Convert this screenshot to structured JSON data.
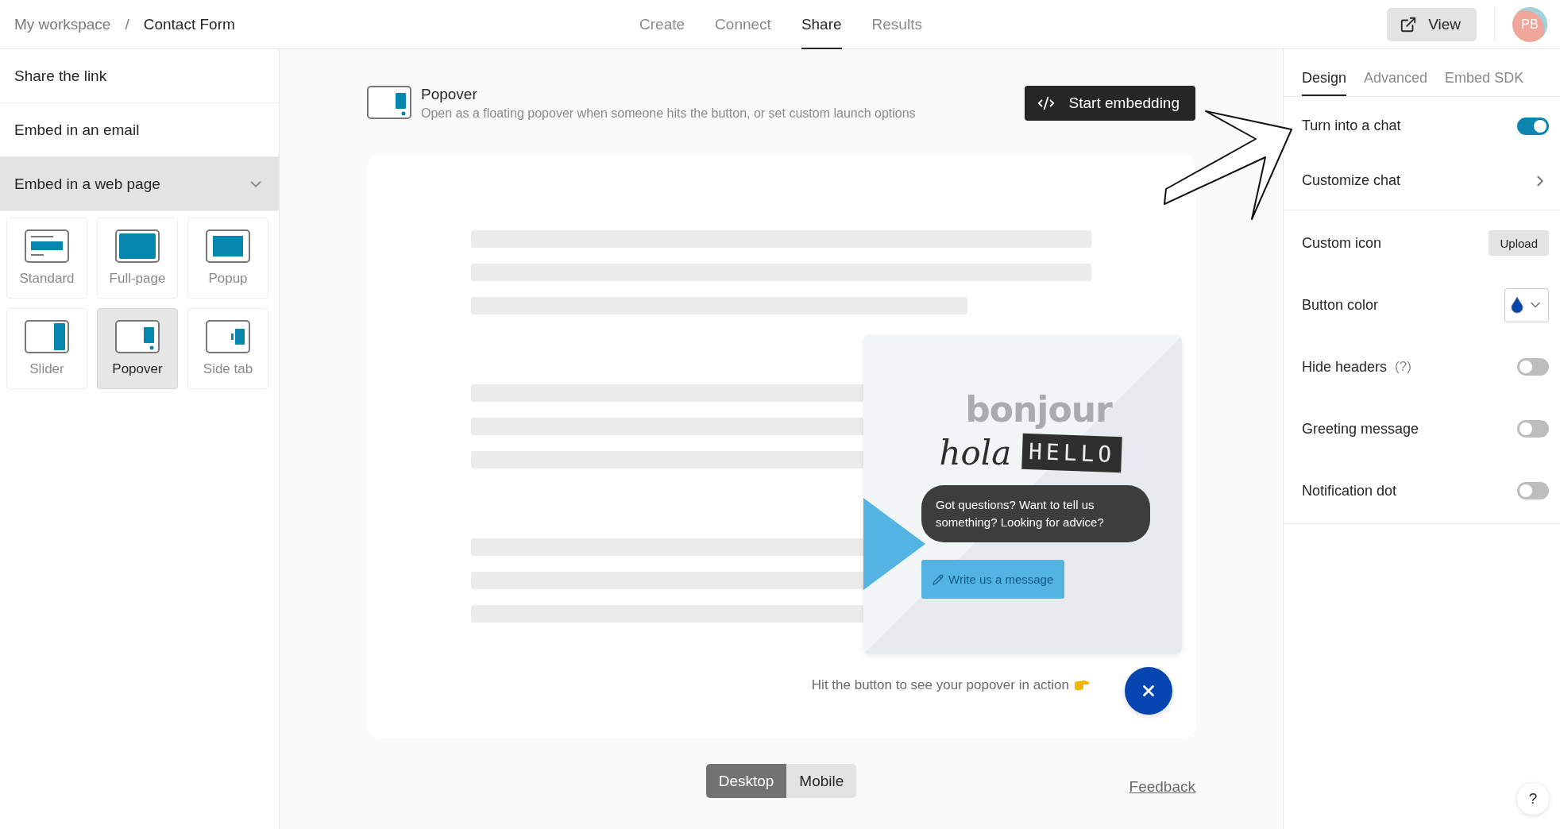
{
  "breadcrumb": {
    "workspace": "My workspace",
    "separator": "/",
    "form": "Contact Form"
  },
  "nav_tabs": [
    {
      "label": "Create",
      "selected": false
    },
    {
      "label": "Connect",
      "selected": false
    },
    {
      "label": "Share",
      "selected": true
    },
    {
      "label": "Results",
      "selected": false
    }
  ],
  "view_button": "View",
  "avatar": "PB",
  "sidebar": {
    "items": [
      {
        "kind": "link",
        "label": "Share the link",
        "selected": false
      },
      {
        "kind": "link",
        "label": "Embed in an email",
        "selected": false
      },
      {
        "kind": "section",
        "label": "Embed in a web page",
        "selected": true,
        "expanded": true,
        "options": [
          {
            "kind": "standard",
            "label": "Standard",
            "selected": false
          },
          {
            "kind": "full-page",
            "label": "Full-page",
            "selected": false
          },
          {
            "kind": "popup",
            "label": "Popup",
            "selected": false
          },
          {
            "kind": "slider",
            "label": "Slider",
            "selected": false
          },
          {
            "kind": "popover",
            "label": "Popover",
            "selected": true
          },
          {
            "kind": "side-tab",
            "label": "Side tab",
            "selected": false
          }
        ]
      }
    ]
  },
  "header": {
    "title": "Popover",
    "description": "Open as a floating popover when someone hits the button, or set custom launch options",
    "start_button": "Start embedding"
  },
  "preview": {
    "greetings": [
      "bonjour",
      "hola",
      "HELLO"
    ],
    "message": "Got questions? Want to tell us something? Looking for advice?",
    "cta": "Write us a message",
    "hint": "Hit the button to see your popover in action"
  },
  "devices": [
    {
      "label": "Desktop",
      "selected": true
    },
    {
      "label": "Mobile",
      "selected": false
    }
  ],
  "feedback": "Feedback",
  "panel_tabs": [
    {
      "label": "Design",
      "selected": true
    },
    {
      "label": "Advanced",
      "selected": false
    },
    {
      "label": "Embed SDK",
      "selected": false
    }
  ],
  "sections": [
    {
      "rows": [
        {
          "kind": "toggle",
          "label": "Turn into a chat",
          "on": true
        },
        {
          "kind": "link",
          "label": "Customize chat"
        }
      ]
    },
    {
      "rows": [
        {
          "kind": "upload",
          "label": "Custom icon",
          "button": "Upload"
        },
        {
          "kind": "color",
          "label": "Button color",
          "color": "#0445af"
        },
        {
          "kind": "toggle",
          "label": "Hide headers",
          "hint": "(?)",
          "on": false
        },
        {
          "kind": "toggle",
          "label": "Greeting message",
          "on": false
        },
        {
          "kind": "toggle",
          "label": "Notification dot",
          "on": false
        }
      ]
    }
  ],
  "help": "?"
}
